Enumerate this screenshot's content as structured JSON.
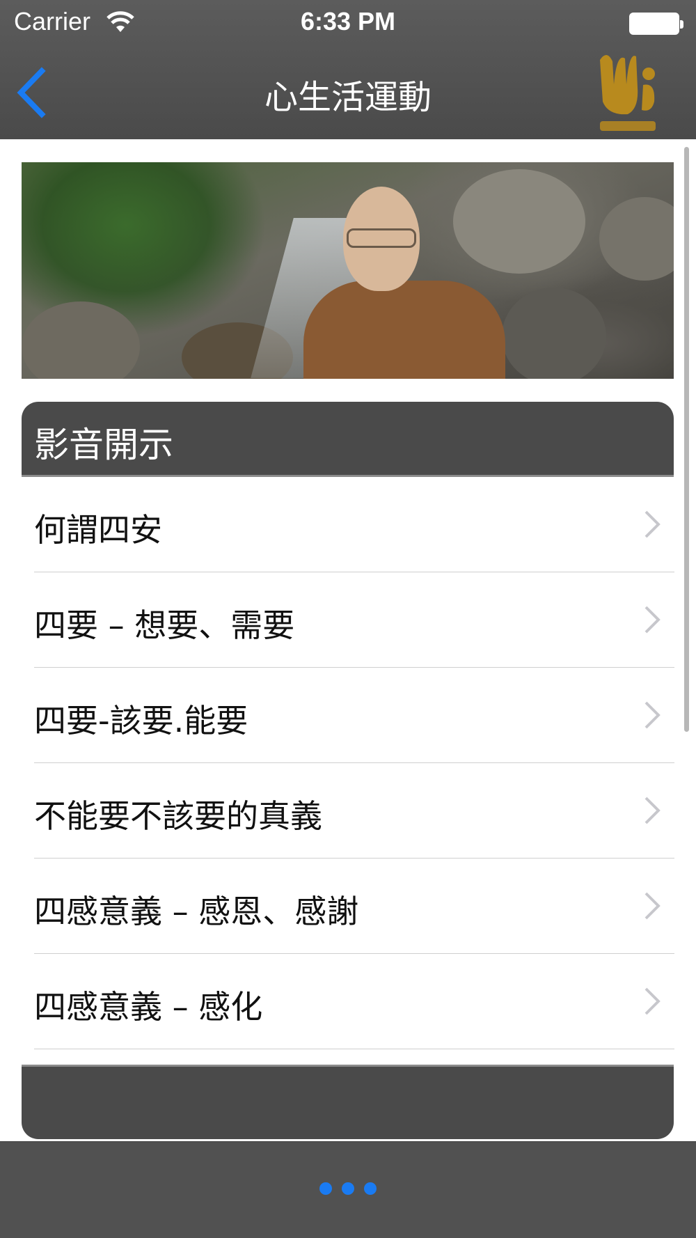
{
  "status_bar": {
    "carrier": "Carrier",
    "time": "6:33 PM"
  },
  "nav": {
    "title": "心生活運動",
    "back_icon": "chevron-left-icon",
    "logo_icon": "dharma-drum-logo",
    "accent_color": "#1a7bf2"
  },
  "banner": {
    "image": "monk-by-stream-photo"
  },
  "section": {
    "title": "影音開示"
  },
  "list": {
    "items": [
      {
        "label": "何謂四安"
      },
      {
        "label": "四要 – 想要、需要"
      },
      {
        "label": "四要-該要.能要"
      },
      {
        "label": "不能要不該要的真義"
      },
      {
        "label": "四感意義 – 感恩、感謝"
      },
      {
        "label": "四感意義 – 感化"
      }
    ]
  },
  "tabbar": {
    "more_icon": "more-dots-icon"
  }
}
